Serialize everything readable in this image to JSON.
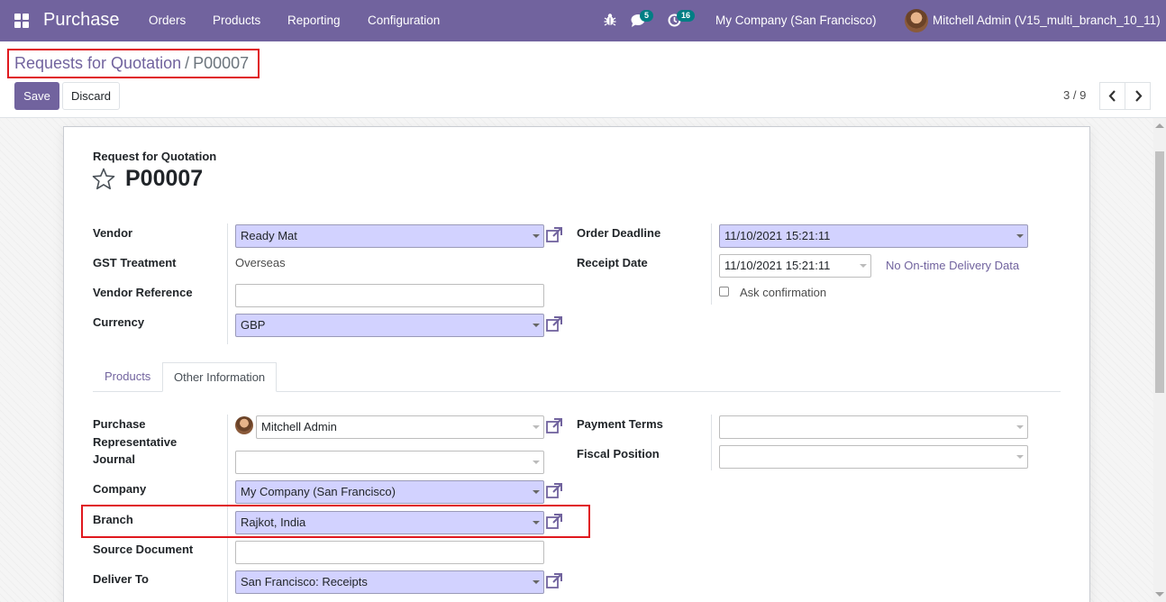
{
  "navbar": {
    "app_name": "Purchase",
    "menu": [
      "Orders",
      "Products",
      "Reporting",
      "Configuration"
    ],
    "messages_count": "5",
    "activities_count": "16",
    "company": "My Company (San Francisco)",
    "user": "Mitchell Admin (V15_multi_branch_10_11)"
  },
  "breadcrumb": {
    "parent": "Requests for Quotation",
    "separator": "/",
    "current": "P00007"
  },
  "buttons": {
    "save": "Save",
    "discard": "Discard"
  },
  "pager": {
    "text": "3 / 9"
  },
  "form": {
    "subtitle": "Request for Quotation",
    "reference": "P00007",
    "left": {
      "vendor_label": "Vendor",
      "vendor_value": "Ready Mat",
      "gst_label": "GST Treatment",
      "gst_value": "Overseas",
      "vendor_ref_label": "Vendor Reference",
      "vendor_ref_value": "",
      "currency_label": "Currency",
      "currency_value": "GBP"
    },
    "right": {
      "order_deadline_label": "Order Deadline",
      "order_deadline_value": "11/10/2021 15:21:11",
      "receipt_date_label": "Receipt Date",
      "receipt_date_value": "11/10/2021 15:21:11",
      "on_time_link": "No On-time Delivery Data",
      "ask_confirmation": "Ask confirmation"
    },
    "tabs": [
      {
        "label": "Products",
        "active": false
      },
      {
        "label": "Other Information",
        "active": true
      }
    ],
    "other_info": {
      "purchase_rep_label_1": "Purchase",
      "purchase_rep_label_2": "Representative",
      "purchase_rep_value": "Mitchell Admin",
      "journal_label": "Journal",
      "journal_value": "",
      "company_label": "Company",
      "company_value": "My Company (San Francisco)",
      "branch_label": "Branch",
      "branch_value": "Rajkot, India",
      "source_doc_label": "Source Document",
      "source_doc_value": "",
      "deliver_to_label": "Deliver To",
      "deliver_to_value": "San Francisco: Receipts",
      "payment_terms_label": "Payment Terms",
      "payment_terms_value": "",
      "fiscal_position_label": "Fiscal Position",
      "fiscal_position_value": ""
    }
  },
  "colors": {
    "brand": "#71639e",
    "required_field": "#d2d2ff",
    "highlight": "#e0181e",
    "badge": "#017e84"
  },
  "icons": [
    "apps-grid-icon",
    "bug-icon",
    "chat-icon",
    "activity-clock-icon",
    "star-icon",
    "external-link-icon",
    "chevron-left-icon",
    "chevron-right-icon",
    "caret-down-icon"
  ]
}
